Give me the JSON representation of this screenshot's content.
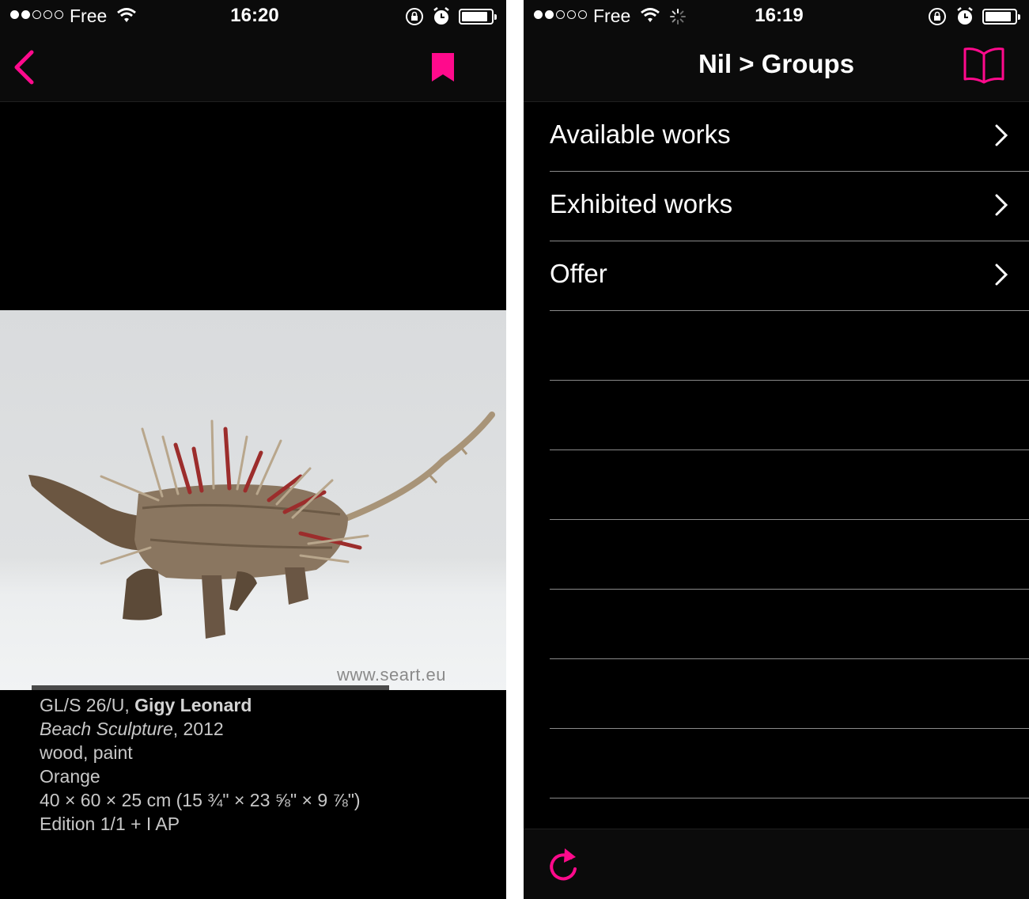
{
  "colors": {
    "accent": "#ff0a8c",
    "background": "#000000",
    "bar": "#0b0b0b"
  },
  "left_screen": {
    "status": {
      "carrier": "Free",
      "time": "16:20"
    },
    "nav": {
      "back_icon": "chevron-left-icon",
      "bookmark_icon": "bookmark-icon"
    },
    "artwork": {
      "watermark": "www.seart.eu"
    },
    "caption": {
      "code": "GL/S 26/U, ",
      "artist": "Gigy Leonard",
      "title": "Beach Sculpture",
      "year": ", 2012",
      "medium": "wood, paint",
      "color": "Orange",
      "dimensions": "40 × 60 × 25 cm (15 ¾\" × 23 ⅝\" × 9 ⅞\")",
      "edition": "Edition 1/1 + I AP"
    }
  },
  "right_screen": {
    "status": {
      "carrier": "Free",
      "time": "16:19"
    },
    "nav": {
      "title": "Nil > Groups",
      "book_icon": "book-icon"
    },
    "menu": [
      {
        "label": "Available works"
      },
      {
        "label": "Exhibited works"
      },
      {
        "label": "Offer"
      }
    ],
    "toolbar": {
      "refresh_icon": "refresh-icon"
    }
  }
}
